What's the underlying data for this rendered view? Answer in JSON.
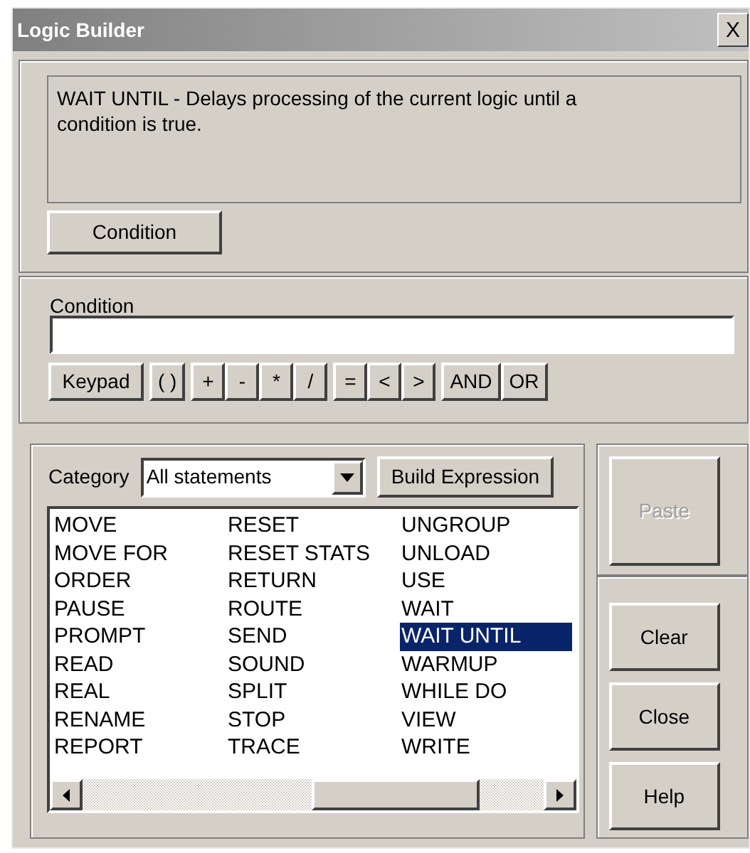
{
  "window": {
    "title": "Logic Builder",
    "close": "X"
  },
  "description": "WAIT UNTIL - Delays processing of the current logic until a condition is true.",
  "mode_button": "Condition",
  "condition": {
    "label": "Condition"
  },
  "keypad": [
    "Keypad",
    "( )",
    "+",
    "-",
    "*",
    "/",
    "=",
    "<",
    ">",
    "AND",
    "OR"
  ],
  "category": {
    "label": "Category",
    "value": "All statements",
    "build_button": "Build Expression"
  },
  "statements": [
    [
      {
        "text": "MOVE",
        "selected": false
      },
      {
        "text": "MOVE FOR",
        "selected": false
      },
      {
        "text": "ORDER",
        "selected": false
      },
      {
        "text": "PAUSE",
        "selected": false
      },
      {
        "text": "PROMPT",
        "selected": false
      },
      {
        "text": "READ",
        "selected": false
      },
      {
        "text": "REAL",
        "selected": false
      },
      {
        "text": "RENAME",
        "selected": false
      },
      {
        "text": "REPORT",
        "selected": false
      }
    ],
    [
      {
        "text": "RESET",
        "selected": false
      },
      {
        "text": "RESET STATS",
        "selected": false
      },
      {
        "text": "RETURN",
        "selected": false
      },
      {
        "text": "ROUTE",
        "selected": false
      },
      {
        "text": "SEND",
        "selected": false
      },
      {
        "text": "SOUND",
        "selected": false
      },
      {
        "text": "SPLIT",
        "selected": false
      },
      {
        "text": "STOP",
        "selected": false
      },
      {
        "text": "TRACE",
        "selected": false
      }
    ],
    [
      {
        "text": "UNGROUP",
        "selected": false
      },
      {
        "text": "UNLOAD",
        "selected": false
      },
      {
        "text": "USE",
        "selected": false
      },
      {
        "text": "WAIT",
        "selected": false
      },
      {
        "text": "WAIT UNTIL",
        "selected": true
      },
      {
        "text": "WARMUP",
        "selected": false
      },
      {
        "text": "WHILE DO",
        "selected": false
      },
      {
        "text": "VIEW",
        "selected": false
      },
      {
        "text": "WRITE",
        "selected": false
      }
    ]
  ],
  "side_buttons": [
    {
      "label": "Paste",
      "disabled": true
    },
    {
      "label": "Clear",
      "disabled": false
    },
    {
      "label": "Close",
      "disabled": false
    },
    {
      "label": "Help",
      "disabled": false
    }
  ]
}
